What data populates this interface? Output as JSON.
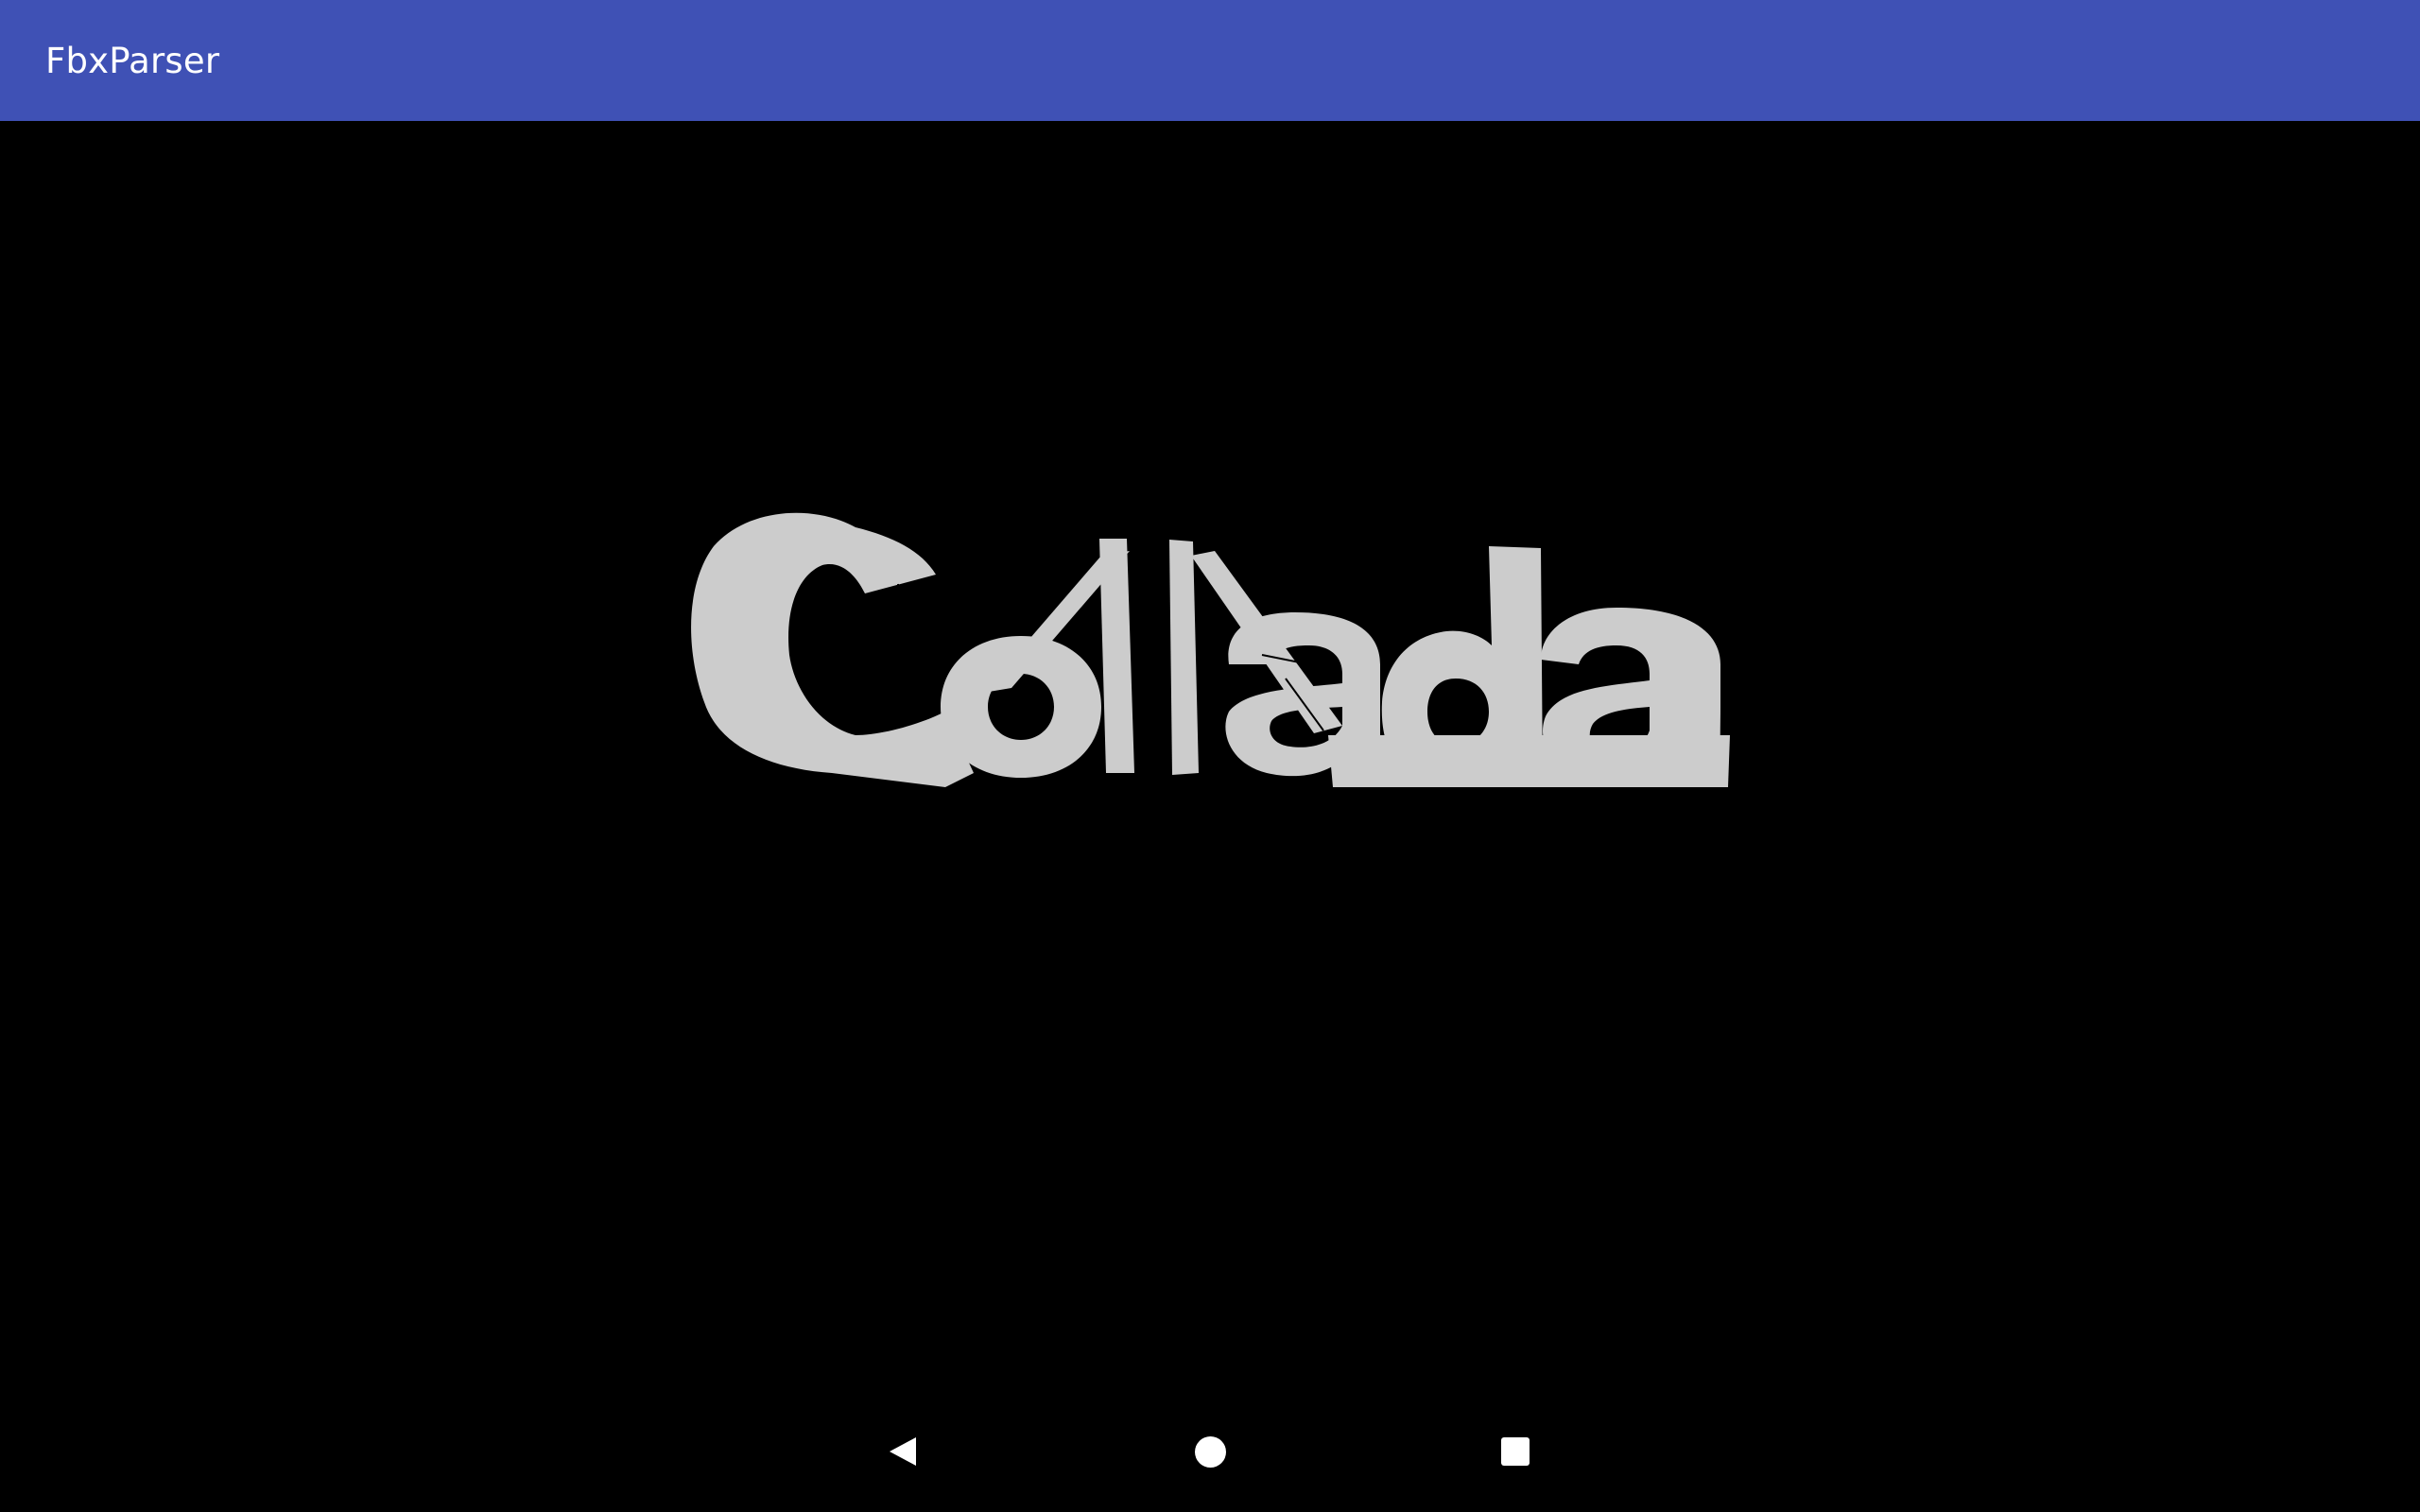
{
  "app_bar": {
    "title": "FbxParser",
    "color": "#3f51b5"
  },
  "viewport": {
    "background": "#000000",
    "model_color": "#cccccc"
  },
  "nav_bar": {
    "back_icon": "back-triangle-icon",
    "home_icon": "home-circle-icon",
    "recents_icon": "recents-square-icon"
  }
}
